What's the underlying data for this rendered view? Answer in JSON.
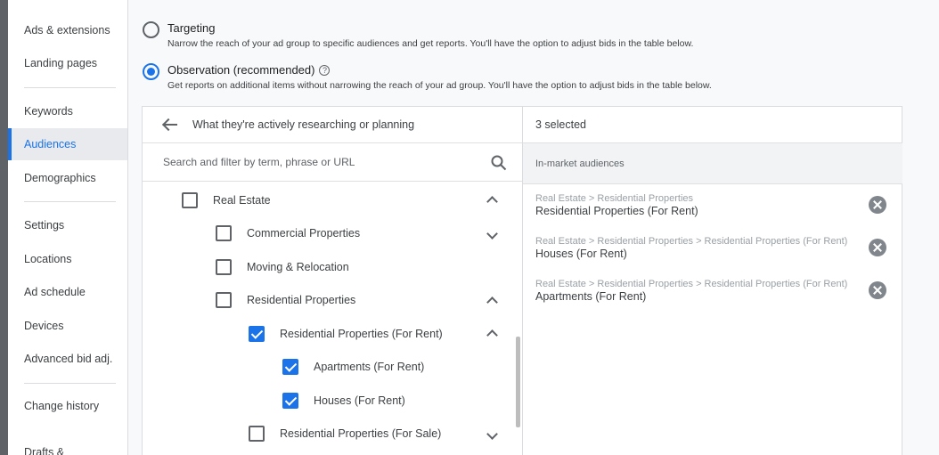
{
  "sidebar": {
    "items": [
      {
        "label": "Ads & extensions"
      },
      {
        "label": "Landing pages"
      },
      {
        "label": "Keywords"
      },
      {
        "label": "Audiences"
      },
      {
        "label": "Demographics"
      },
      {
        "label": "Settings"
      },
      {
        "label": "Locations"
      },
      {
        "label": "Ad schedule"
      },
      {
        "label": "Devices"
      },
      {
        "label": "Advanced bid adj."
      },
      {
        "label": "Change history"
      },
      {
        "label": "Drafts &"
      }
    ],
    "active_item": "Audiences"
  },
  "targeting": {
    "options": [
      {
        "label": "Targeting",
        "description": "Narrow the reach of your ad group to specific audiences and get reports. You'll have the option to adjust bids in the table below.",
        "selected": false
      },
      {
        "label": "Observation (recommended)",
        "description": "Get reports on additional items without narrowing the reach of your ad group. You'll have the option to adjust bids in the table below.",
        "selected": true
      }
    ],
    "help_icon": "?"
  },
  "browse": {
    "title": "What they're actively researching or planning",
    "search_placeholder": "Search and filter by term, phrase or URL",
    "tree": [
      {
        "label": "Real Estate",
        "checked": false,
        "chevron": "up"
      },
      {
        "label": "Commercial Properties",
        "checked": false,
        "chevron": "down"
      },
      {
        "label": "Moving & Relocation",
        "checked": false,
        "chevron": ""
      },
      {
        "label": "Residential Properties",
        "checked": false,
        "chevron": "up"
      },
      {
        "label": "Residential Properties (For Rent)",
        "checked": true,
        "chevron": "up"
      },
      {
        "label": "Apartments (For Rent)",
        "checked": true,
        "chevron": ""
      },
      {
        "label": "Houses (For Rent)",
        "checked": true,
        "chevron": ""
      },
      {
        "label": "Residential Properties (For Sale)",
        "checked": false,
        "chevron": "down"
      }
    ]
  },
  "selected": {
    "count_label": "3 selected",
    "section_label": "In-market audiences",
    "items": [
      {
        "path": "Real Estate > Residential Properties",
        "name": "Residential Properties (For Rent)"
      },
      {
        "path": "Real Estate > Residential Properties > Residential Properties (For Rent)",
        "name": "Houses (For Rent)"
      },
      {
        "path": "Real Estate > Residential Properties > Residential Properties (For Rent)",
        "name": "Apartments (For Rent)"
      }
    ]
  },
  "colors": {
    "accent": "#1a73e8",
    "remove_button": "#80868b"
  }
}
